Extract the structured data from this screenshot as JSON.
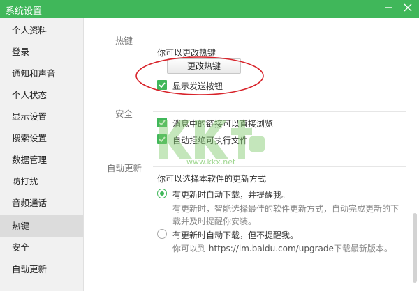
{
  "window": {
    "title": "系统设置",
    "minimize_icon": "minimize-icon",
    "close_icon": "close-icon",
    "accent": "#40b75a"
  },
  "sidebar": {
    "items": [
      {
        "label": "个人资料"
      },
      {
        "label": "登录"
      },
      {
        "label": "通知和声音"
      },
      {
        "label": "个人状态"
      },
      {
        "label": "显示设置"
      },
      {
        "label": "搜索设置"
      },
      {
        "label": "数据管理"
      },
      {
        "label": "防打扰"
      },
      {
        "label": "音频通话"
      },
      {
        "label": "热键",
        "active": true
      },
      {
        "label": "安全"
      },
      {
        "label": "自动更新"
      }
    ]
  },
  "hotkey": {
    "section_label": "热键",
    "hint": "你可以更改热键",
    "change_button": "更改热键",
    "show_send_button_label": "显示发送按钮",
    "show_send_button_checked": true
  },
  "security": {
    "section_label": "安全",
    "link_browse_label": "消息中的链接可以直接浏览",
    "link_browse_checked": true,
    "block_exec_label": "自动拒绝可执行文件",
    "block_exec_checked": true
  },
  "auto_update": {
    "section_label": "自动更新",
    "hint": "你可以选择本软件的更新方式",
    "option1_label": "有更新时自动下载，并提醒我。",
    "option1_selected": true,
    "option1_desc_line1": "有更新时，智能选择最佳的软件更新方式，自动完成更新的下",
    "option1_desc_line2": "载并及时提醒你安装。",
    "option2_label": "有更新时自动下载，但不提醒我。",
    "option2_selected": false,
    "option2_desc_prefix": "你可以到",
    "option2_desc_url": "https://im.baidu.com/upgrade",
    "option2_desc_suffix": "下载最新版本。"
  },
  "watermark": {
    "text": "www.kkx.net"
  }
}
